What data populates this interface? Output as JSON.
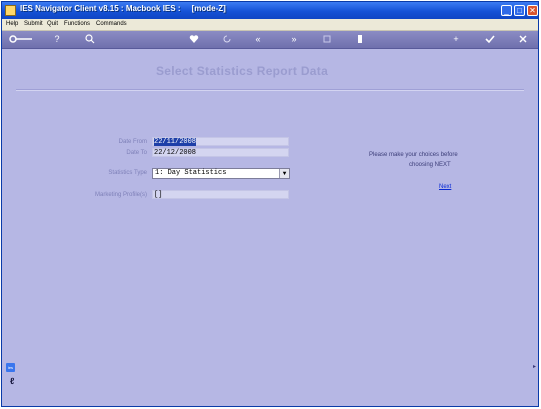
{
  "window": {
    "title": "IES Navigator Client v8.15 : Macbook IES :     [mode-Z]",
    "min_glyph": "_",
    "max_glyph": "□",
    "close_glyph": "✕"
  },
  "menu": [
    "Help",
    "Submit",
    "Quit",
    "Functions",
    "Commands"
  ],
  "toolbar": {
    "icons": [
      "key-icon",
      "help-icon",
      "search-icon",
      "heart-icon",
      "refresh-icon",
      "back-icon",
      "forward-icon",
      "filter-icon",
      "gear-icon",
      "add-icon",
      "ok-icon",
      "cancel-icon"
    ],
    "help_glyph": "?",
    "back_glyph": "«",
    "forward_glyph": "»",
    "add_glyph": "+"
  },
  "page": {
    "title": "Select Statistics Report Data"
  },
  "form": {
    "date_from_label": "Date From",
    "date_from_value": "22/11/2008",
    "date_to_label": "Date To",
    "date_to_value": "22/12/2008",
    "stat_type_label": "Statistics Type",
    "stat_type_value": "1: Day Statistics",
    "stat_arrow": "▼",
    "marketing_label": "Marketing Profile(s)",
    "marketing_value": "[]"
  },
  "hint": {
    "line1": "Please make your choices before",
    "line2": "choosing NEXT",
    "next_link": "Next"
  },
  "footer": {
    "badge": "ies",
    "glyph": "ℓ"
  },
  "colors": {
    "background": "#b6b7e4",
    "titlebar": "#1552d6",
    "toolbar": "#7374b2",
    "link": "#0a2ad4"
  }
}
